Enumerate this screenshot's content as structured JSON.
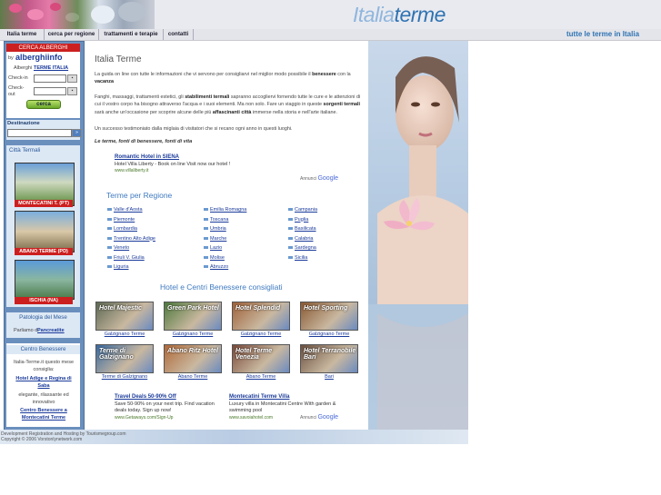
{
  "header": {
    "logo_a": "Italia",
    "logo_b": "terme",
    "tagline": "tutte le terme in Italia"
  },
  "nav": [
    "Italia terme",
    "cerca per regione",
    "trattamenti e terapie",
    "contatti"
  ],
  "sidebar": {
    "search_title": "CERCA ALBERGHI",
    "by": "by",
    "brand": "alberghiinfo",
    "alberghi_label": "Alberghi",
    "alberghi_link": "TERME ITALIA",
    "checkin_label": "Check-in",
    "checkout_label": "Check-out",
    "search_button": "cerca",
    "destination_label": "Destinazione",
    "cities_title": "Città Termali",
    "cities": [
      "MONTECATINI T. (PT)",
      "ABANO TERME (PD)",
      "ISCHIA (NA)"
    ],
    "month_title": "Patologia del Mese",
    "month_text": "Parliamo di",
    "month_link": "Pancreatite",
    "wellness_title": "Centro Benessere",
    "wellness_text1": "Italia-Terme.it questo mese consiglia:",
    "wellness_link1": "Hotel Adige e Regina di Saba",
    "wellness_text2": "elegante, rilassante ed innovativo",
    "wellness_link2": "Centro Benessere a Montecatini Terme"
  },
  "main": {
    "title": "Italia Terme",
    "p1_a": "La guida on line con tutte le informazioni che vi servono per consigliarvi nel miglior modo possibile il",
    "p1_b": "benessere",
    "p1_c": "con la",
    "p1_d": "vacanza",
    "p2_a": "Fanghi, massaggi, trattamenti estetici, gli",
    "p2_b": "stabilimenti termali",
    "p2_c": "sapranno accogliervi fornendo tutte le cure e le attenzioni di cui il vostro corpo ha bisogno attraverso l'acqua e i suoi elementi. Ma non solo. Fare un viaggio in queste",
    "p2_d": "sorgenti termali",
    "p2_e": "sarà anche un'occasione per scoprire alcune delle più",
    "p2_f": "affascinanti città",
    "p2_g": "immerse nella storia e nell'arte italiane.",
    "p3": "Un successo testimoniato dalla miglaia di visitatori che si recano ogni anno in questi luoghi.",
    "motto": "Le terme, fonti di benessere, fonti di vita",
    "ad1_title": "Romantic Hotel in SIENA",
    "ad1_text": "Hotel Villa Liberty - Book on line Visit now our hotel !",
    "ad1_url": "www.villaliberty.it",
    "ads_by": "Annunci",
    "google": "Google",
    "regions_title": "Terme per Regione",
    "regions_col1": [
      "Valle d'Aosta",
      "Piemonte",
      "Lombardia",
      "Trentino Alto Adige",
      "Veneto",
      "Friuli V. Giulia",
      "Liguria"
    ],
    "regions_col2": [
      "Emilia Romagna",
      "Toscana",
      "Umbria",
      "Marche",
      "Lazio",
      "Molise",
      "Abruzzo"
    ],
    "regions_col3": [
      "Campania",
      "Puglia",
      "Basilicata",
      "Calabria",
      "Sardegna",
      "Sicilia"
    ],
    "hotels_title": "Hotel e Centri Benessere consigliati",
    "hotels": [
      {
        "name": "Hotel Majestic",
        "label": "Galzignano Terme",
        "color": "#5f6a55"
      },
      {
        "name": "Green Park Hotel",
        "label": "Galzignano Terme",
        "color": "#4f7a3e"
      },
      {
        "name": "Hotel Splendid",
        "label": "Galzignano Terme",
        "color": "#a0623a"
      },
      {
        "name": "Hotel Sporting",
        "label": "Galzignano Terme",
        "color": "#8a5a34"
      },
      {
        "name": "Terme di Galzignano",
        "label": "Terme di Galzignano",
        "color": "#3a6aa0"
      },
      {
        "name": "Abano Ritz Hotel",
        "label": "Abano Terme",
        "color": "#b06a3a"
      },
      {
        "name": "Hotel Terme Venezia",
        "label": "Abano Terme",
        "color": "#7a4a3a"
      },
      {
        "name": "Hotel Terranobile Bari",
        "label": "Bari",
        "color": "#6a5040"
      }
    ],
    "ad2_title": "Travel Deals 50-90% Off",
    "ad2_text": "Save 50-90% on your next trip. Find vacation deals today. Sign up now!",
    "ad2_url": "www.Getaways.com/Sign-Up",
    "ad3_title": "Montecatini Terme Villa",
    "ad3_text": "Luxury villa in Montecatini Centre With garden & swimming pool",
    "ad3_url": "www.savoiahotel.com"
  },
  "footer": {
    "line1": "Development Registration and Hosting by Tourismegroup.com",
    "line2": "Copyright © 2006 Vorstonlynetwork.com"
  }
}
